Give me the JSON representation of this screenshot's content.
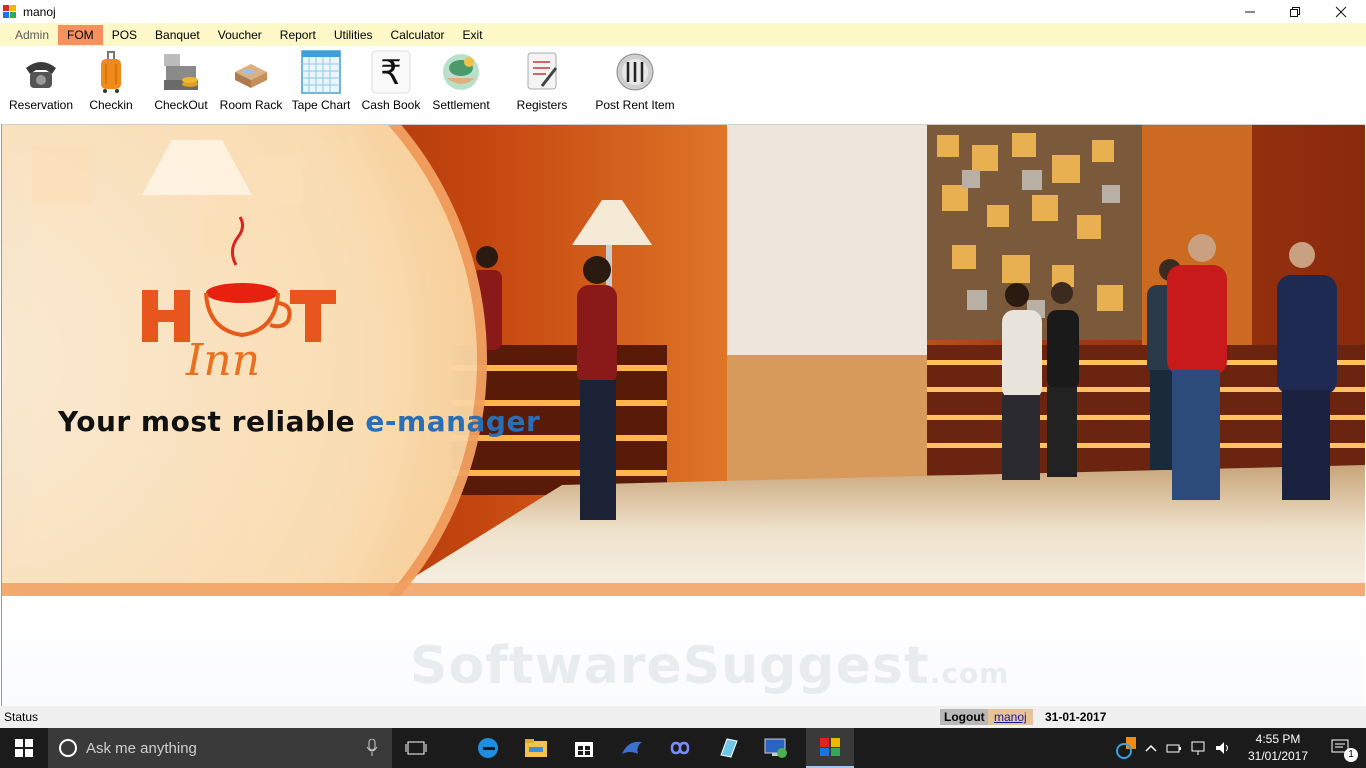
{
  "window": {
    "title": "manoj"
  },
  "menu": [
    {
      "label": "Admin",
      "muted": true
    },
    {
      "label": "FOM",
      "active": true
    },
    {
      "label": "POS"
    },
    {
      "label": "Banquet"
    },
    {
      "label": "Voucher"
    },
    {
      "label": "Report"
    },
    {
      "label": "Utilities"
    },
    {
      "label": "Calculator"
    },
    {
      "label": "Exit"
    }
  ],
  "toolbar": {
    "reservation": "Reservation",
    "checkin": "Checkin",
    "checkout": "CheckOut",
    "room_rack": "Room Rack",
    "tape_chart": "Tape Chart",
    "cash_book": "Cash Book",
    "settlement": "Settlement",
    "registers": "Registers",
    "post_rent_item": "Post Rent Item"
  },
  "hero": {
    "logo_text": "HOT Inn",
    "tagline_plain": "Your most reliable ",
    "tagline_accent": "e-manager"
  },
  "watermark": {
    "main": "SoftwareSuggest",
    "suffix": ".com"
  },
  "status": {
    "label": "Status",
    "logout": "Logout",
    "user": "manoj",
    "date": "31-01-2017"
  },
  "taskbar": {
    "search_placeholder": "Ask me anything",
    "time": "4:55 PM",
    "date": "31/01/2017",
    "notification_count": "1"
  },
  "colors": {
    "menubar_bg": "#fcf8c8",
    "menu_active": "#f6905e",
    "accent_orange": "#e8561e",
    "tagline_blue": "#2a6fb5",
    "taskbar_bg": "#1b1b1b"
  }
}
